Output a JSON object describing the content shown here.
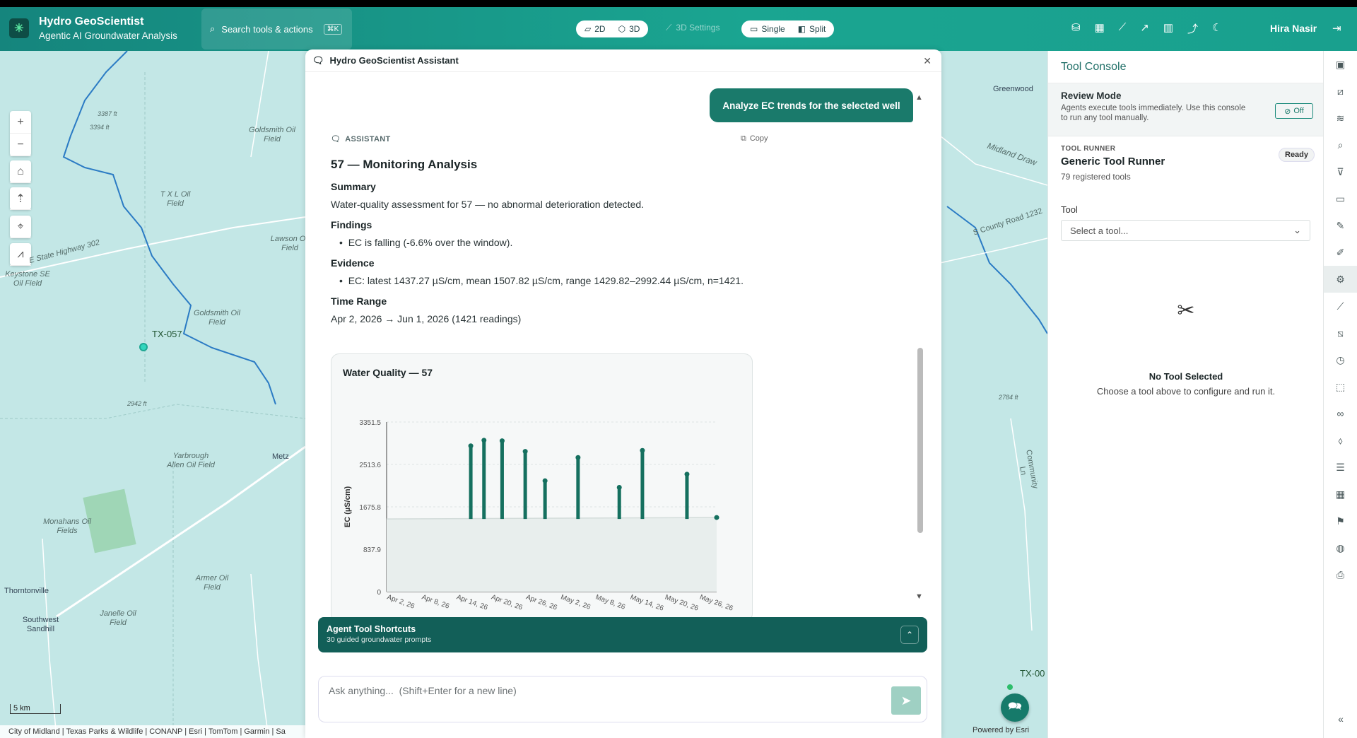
{
  "header": {
    "app_title": "Hydro GeoScientist",
    "app_subtitle": "Agentic AI Groundwater Analysis",
    "search_placeholder": "Search tools & actions",
    "search_shortcut": "⌘K",
    "view_2d": "2D",
    "view_3d": "3D",
    "settings_3d": "3D Settings",
    "single": "Single",
    "split": "Split",
    "user": "Hira Nasir"
  },
  "map": {
    "labels": {
      "well_a": "TX-057",
      "well_b": "TX-00",
      "greenwood": "Greenwood",
      "goldsmith_top": "Goldsmith Oil Field",
      "goldsmith_mid": "Goldsmith Oil Field",
      "txl": "T X L Oil Field",
      "lawson": "Lawson Oil Field",
      "keystone": "Keystone SE Oil Field",
      "yarbrough": "Yarbrough Allen Oil Field",
      "metz": "Metz",
      "monahans": "Monahans Oil Fields",
      "armer": "Armer Oil Field",
      "thorntonville": "Thorntonville",
      "janelle": "Janelle Oil Field",
      "southwest_sandhill": "Southwest Sandhill",
      "highway": "E State Highway 302",
      "midland": "Midland Draw",
      "county_road": "S County Road 1232",
      "community": "Community Ln",
      "elev1": "3387 ft",
      "elev2": "3394 ft",
      "elev3": "2942 ft",
      "elev4": "2784 ft"
    },
    "scale": "5 km",
    "attribution": "City of Midland | Texas Parks & Wildlife | CONANP | Esri | TomTom | Garmin | Sa",
    "powered": "Powered by Esri"
  },
  "assistant": {
    "window_title": "Hydro GeoScientist Assistant",
    "user_message": "Analyze EC trends for the selected well",
    "role": "ASSISTANT",
    "copy": "Copy",
    "title": "57 — Monitoring Analysis",
    "summary_h": "Summary",
    "summary": "Water-quality assessment for 57 — no abnormal deterioration detected.",
    "findings_h": "Findings",
    "finding1": "EC is falling (-6.6% over the window).",
    "evidence_h": "Evidence",
    "evidence1": "EC: latest 1437.27 µS/cm, mean 1507.82 µS/cm, range 1429.82–2992.44 µS/cm, n=1421.",
    "range_h": "Time Range",
    "range": "Apr 2, 2026 → Jun 1, 2026 (1421 readings)",
    "shortcuts_title": "Agent Tool Shortcuts",
    "shortcuts_sub": "30 guided groundwater prompts",
    "input_placeholder": "Ask anything...  (Shift+Enter for a new line)"
  },
  "chart_data": {
    "type": "line",
    "title": "Water Quality — 57",
    "ylabel": "EC (µS/cm)",
    "ylim": [
      0,
      3351.5
    ],
    "yticks": [
      "3351.5",
      "2513.6",
      "1675.8",
      "837.9",
      "0"
    ],
    "xticks": [
      "Apr 2, 26",
      "Apr 8, 26",
      "Apr 14, 26",
      "Apr 20, 26",
      "Apr 26, 26",
      "May 2, 26",
      "May 8, 26",
      "May 14, 26",
      "May 20, 26",
      "May 26, 26"
    ],
    "baseline": 1437,
    "spikes": [
      {
        "x": 0.255,
        "y": 2880
      },
      {
        "x": 0.295,
        "y": 2990
      },
      {
        "x": 0.35,
        "y": 2980
      },
      {
        "x": 0.42,
        "y": 2770
      },
      {
        "x": 0.48,
        "y": 2190
      },
      {
        "x": 0.58,
        "y": 2650
      },
      {
        "x": 0.705,
        "y": 2060
      },
      {
        "x": 0.775,
        "y": 2790
      },
      {
        "x": 0.91,
        "y": 2320
      }
    ],
    "last_point": 1437.27
  },
  "console": {
    "title": "Tool Console",
    "review_title": "Review Mode",
    "review_desc": "Agents execute tools immediately. Use this console to run any tool manually.",
    "review_toggle": "Off",
    "runner_kicker": "TOOL RUNNER",
    "runner_name": "Generic Tool Runner",
    "runner_count": "79 registered tools",
    "ready": "Ready",
    "tool_label": "Tool",
    "tool_placeholder": "Select a tool...",
    "empty_title": "No Tool Selected",
    "empty_desc": "Choose a tool above to configure and run it."
  }
}
